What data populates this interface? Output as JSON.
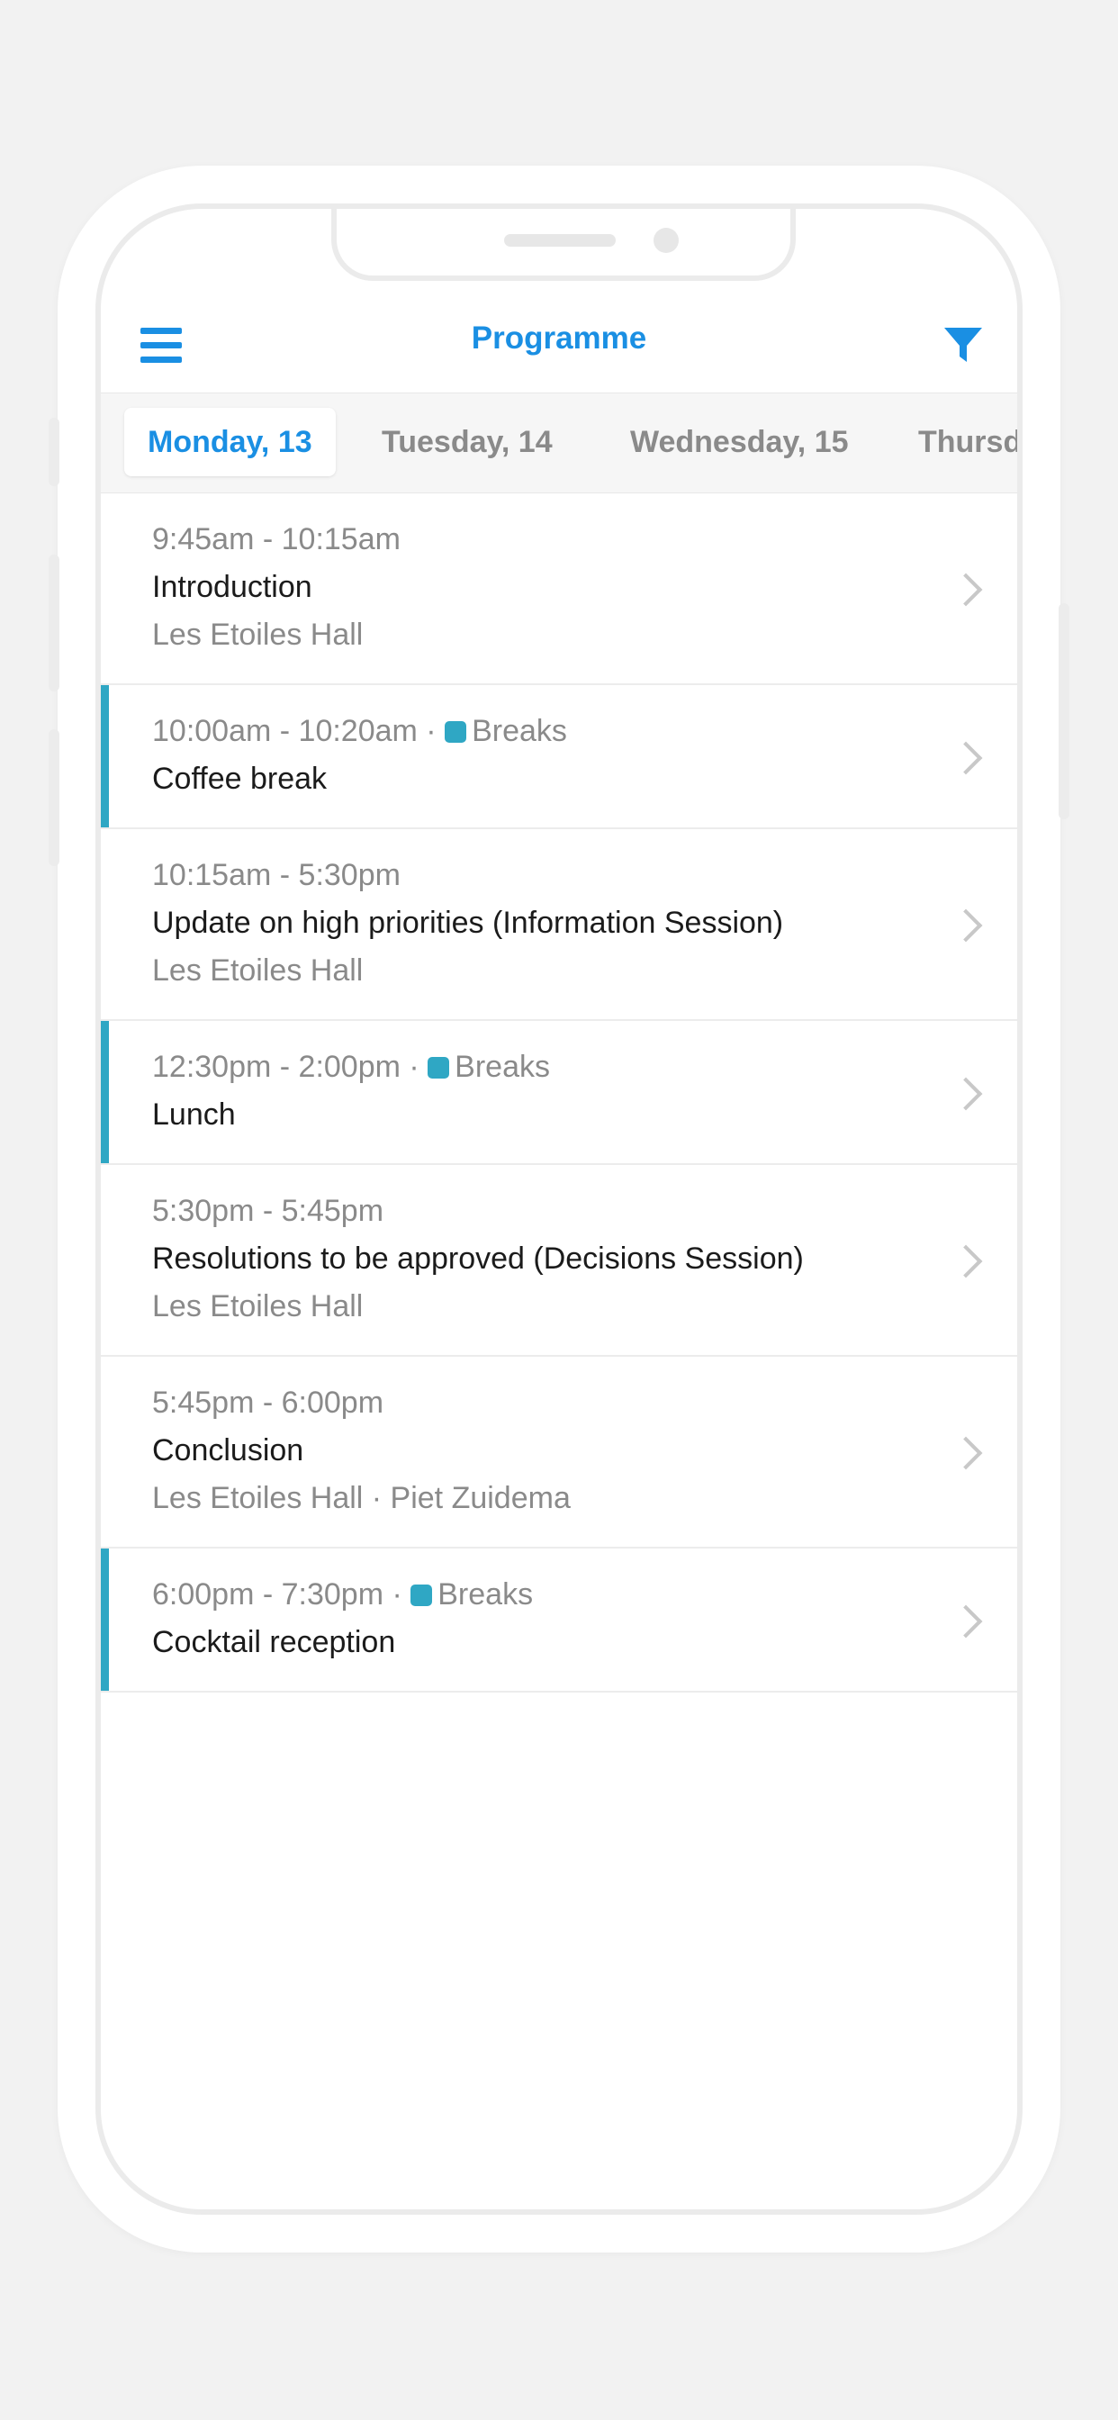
{
  "header": {
    "title": "Programme"
  },
  "icons": {
    "menu": "hamburger-menu-icon",
    "filter": "filter-funnel-icon",
    "chevron": "chevron-right-icon"
  },
  "colors": {
    "accent": "#1a8fe3",
    "breaks_tag": "#2fa7c4"
  },
  "tabs": [
    {
      "label": "Monday, 13",
      "active": true
    },
    {
      "label": "Tuesday, 14",
      "active": false
    },
    {
      "label": "Wednesday, 15",
      "active": false
    },
    {
      "label": "Thursd",
      "active": false
    }
  ],
  "sessions": [
    {
      "time": "9:45am - 10:15am",
      "title": "Introduction",
      "subtitle": "Les Etoiles Hall"
    },
    {
      "time": "10:00am - 10:20am ·",
      "tag": "Breaks",
      "title": "Coffee break"
    },
    {
      "time": "10:15am - 5:30pm",
      "title": "Update on high priorities (Information Session)",
      "subtitle": "Les Etoiles Hall"
    },
    {
      "time": "12:30pm - 2:00pm ·",
      "tag": "Breaks",
      "title": "Lunch"
    },
    {
      "time": "5:30pm - 5:45pm",
      "title": "Resolutions to be approved (Decisions Session)",
      "subtitle": "Les Etoiles Hall"
    },
    {
      "time": "5:45pm - 6:00pm",
      "title": "Conclusion",
      "subtitle": "Les Etoiles Hall · Piet Zuidema"
    },
    {
      "time": "6:00pm - 7:30pm ·",
      "tag": "Breaks",
      "title": "Cocktail reception"
    }
  ]
}
